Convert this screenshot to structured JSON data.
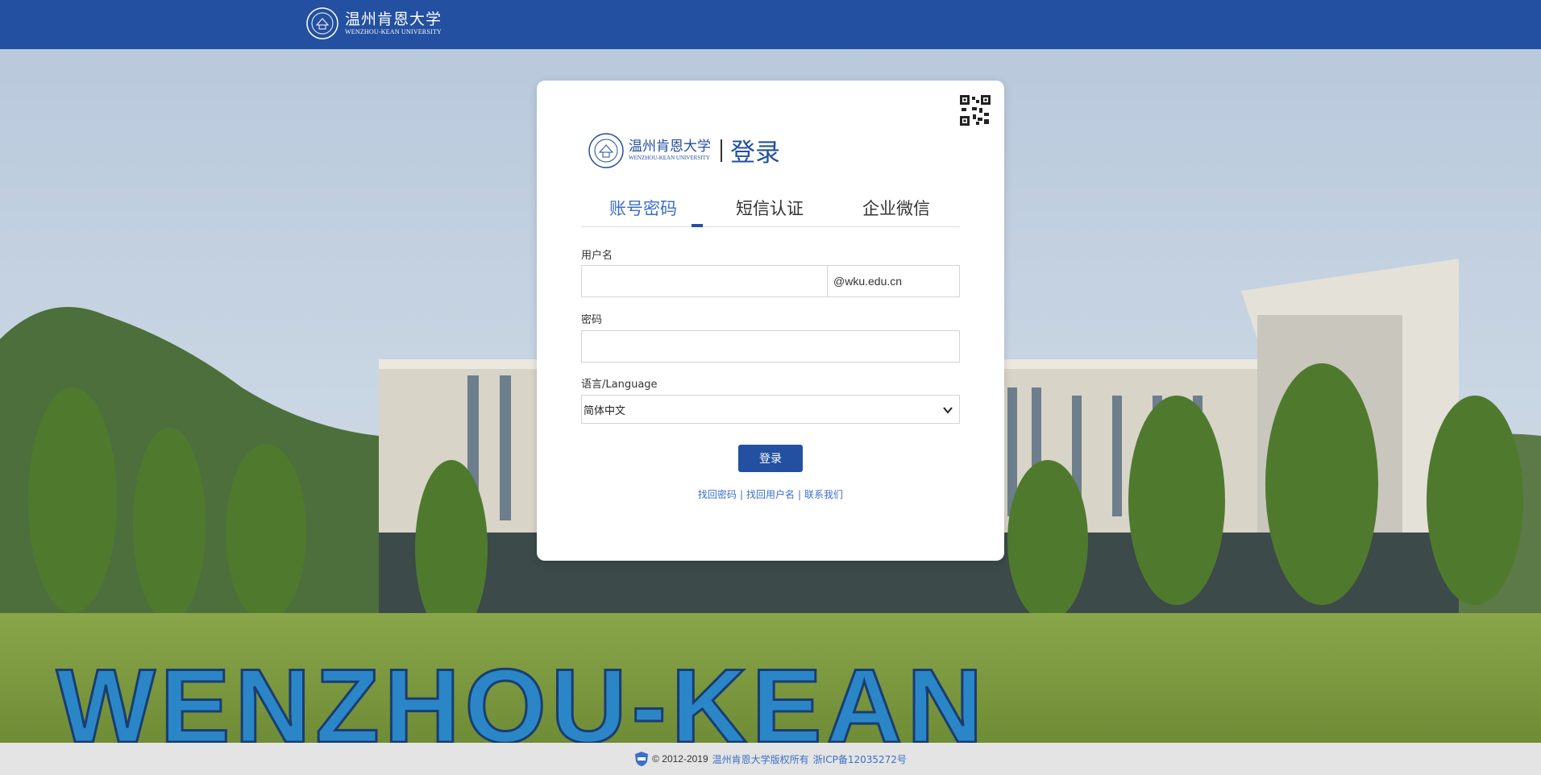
{
  "header": {
    "university_cn": "温州肯恩大学",
    "university_en": "WENZHOU-KEAN UNIVERSITY"
  },
  "card": {
    "logo_cn": "温州肯恩大学",
    "logo_en": "WENZHOU-KEAN UNIVERSITY",
    "title": "登录",
    "tabs": [
      {
        "label": "账号密码",
        "active": true
      },
      {
        "label": "短信认证",
        "active": false
      },
      {
        "label": "企业微信",
        "active": false
      }
    ],
    "username_label": "用户名",
    "username_value": "",
    "email_suffix": "@wku.edu.cn",
    "password_label": "密码",
    "password_value": "",
    "language_label": "语言/Language",
    "language_selected": "简体中文",
    "login_button": "登录",
    "links": [
      "找回密码",
      "找回用户名",
      "联系我们"
    ],
    "link_separator": "|"
  },
  "footer": {
    "copyright": "© 2012-2019",
    "owner_link": "温州肯恩大学版权所有",
    "icp_link": "浙ICP备12035272号"
  },
  "background": {
    "sign_text": "WENZHOU-KEAN"
  },
  "colors": {
    "primary": "#2350a0",
    "link": "#3b6fc9",
    "footer_bg": "#e4e4e4"
  },
  "icons": {
    "qr": "qr-code-icon",
    "select": "chevron-down-icon",
    "badge": "police-badge-icon",
    "seal": "university-seal-icon"
  }
}
